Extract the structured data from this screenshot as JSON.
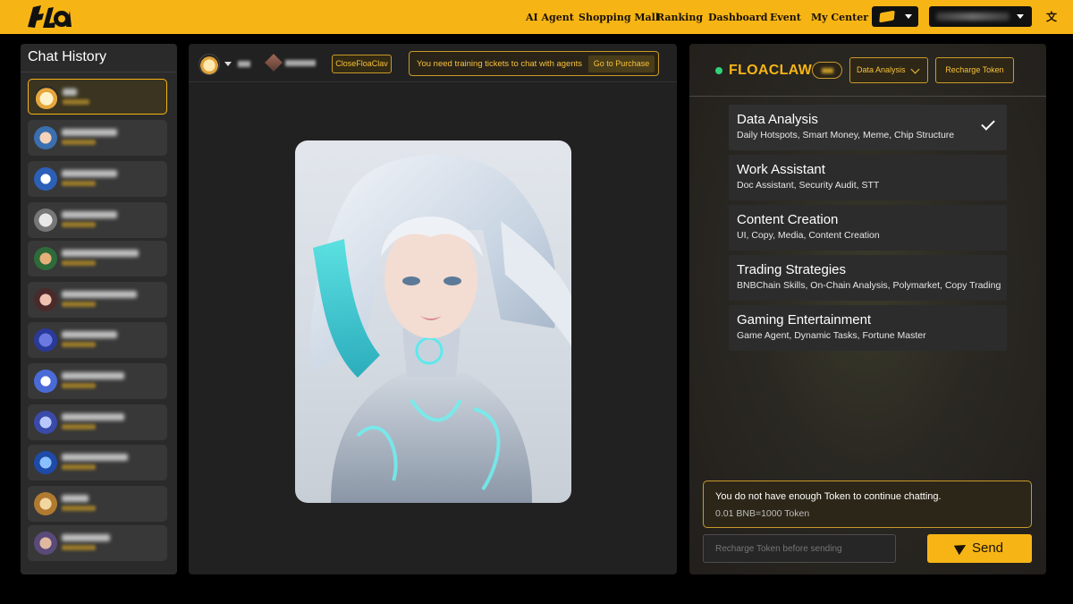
{
  "app": {
    "logo_text": "FLOA"
  },
  "nav": {
    "items": [
      "AI Agent",
      "Shopping Mall",
      "Ranking",
      "Dashboard",
      "Event",
      "My Center"
    ]
  },
  "colors": {
    "accent": "#f7b515",
    "online": "#2fd37a",
    "panel": "#2a2a2a"
  },
  "sidebar": {
    "title": "Chat History",
    "item_count_visible": 12
  },
  "chat_header": {
    "close_button": "CloseFloaClav",
    "ticket_notice": "You need training tickets to chat with agents",
    "purchase_button": "Go to Purchase"
  },
  "agent": {
    "name": "FLOACLAW",
    "mode_button": "Data Analysis",
    "recharge_button": "Recharge Token"
  },
  "categories": [
    {
      "title": "Data Analysis",
      "sub": "Daily Hotspots, Smart Money, Meme, Chip Structure",
      "selected": true
    },
    {
      "title": "Work Assistant",
      "sub": "Doc Assistant, Security Audit, STT",
      "selected": false
    },
    {
      "title": "Content Creation",
      "sub": "UI, Copy, Media, Content Creation",
      "selected": false
    },
    {
      "title": "Trading Strategies",
      "sub": "BNBChain Skills, On-Chain Analysis, Polymarket, Copy Trading",
      "selected": false
    },
    {
      "title": "Gaming Entertainment",
      "sub": "Game Agent, Dynamic Tasks, Fortune Master",
      "selected": false
    }
  ],
  "notice": {
    "line1": "You do not have enough Token to continue chatting.",
    "line2": "0.01 BNB=1000 Token"
  },
  "composer": {
    "placeholder": "Recharge Token before sending",
    "send_label": "Send"
  }
}
